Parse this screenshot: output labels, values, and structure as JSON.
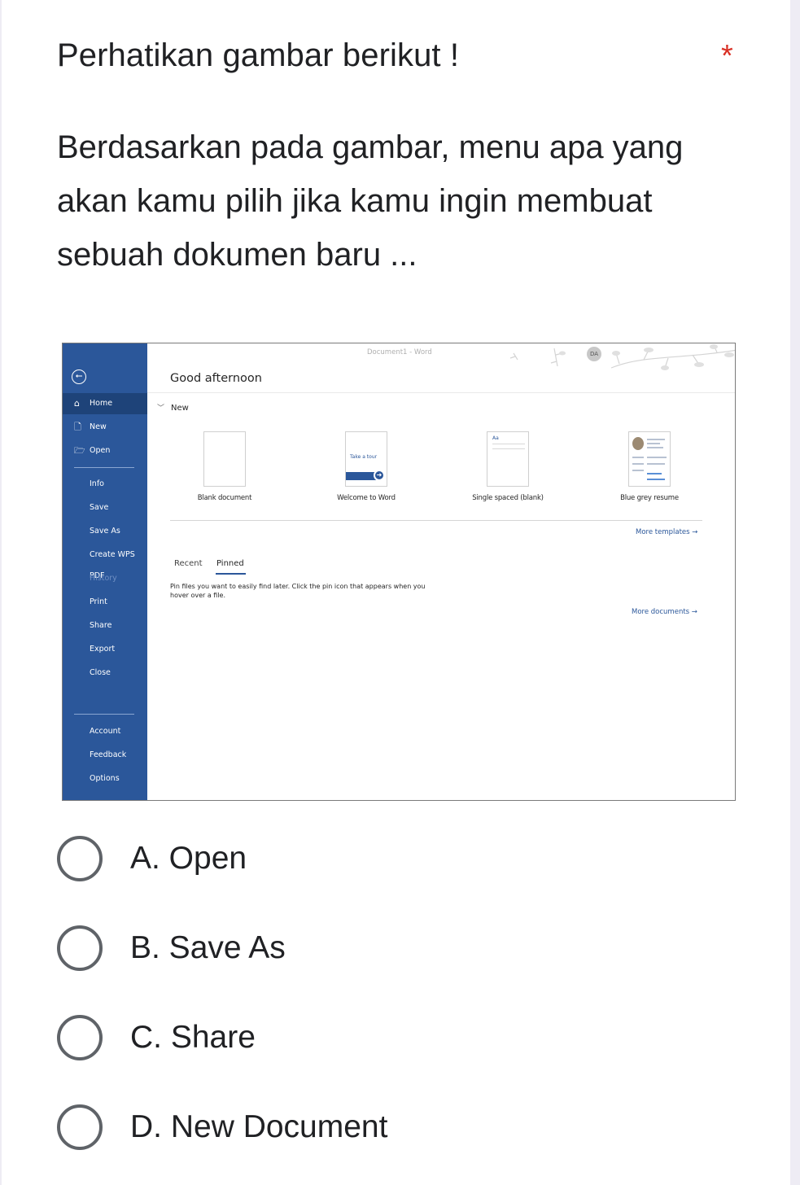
{
  "question": {
    "title": "Perhatikan gambar berikut !",
    "required_marker": "*",
    "body": "Berdasarkan pada gambar, menu apa yang akan kamu pilih jika kamu ingin membuat sebuah dokumen baru ..."
  },
  "word": {
    "window_title": "Document1 - Word",
    "avatar_initials": "DA",
    "greeting": "Good afternoon",
    "sidebar": {
      "back": "⭠",
      "items": [
        {
          "label": "Home",
          "icon": "home-icon"
        },
        {
          "label": "New",
          "icon": "new-document-icon"
        },
        {
          "label": "Open",
          "icon": "folder-open-icon"
        },
        {
          "label": "Info"
        },
        {
          "label": "Save"
        },
        {
          "label": "Save As"
        },
        {
          "label": "Create WPS PDF"
        },
        {
          "label": "History"
        },
        {
          "label": "Print"
        },
        {
          "label": "Share"
        },
        {
          "label": "Export"
        },
        {
          "label": "Close"
        },
        {
          "label": "Account"
        },
        {
          "label": "Feedback"
        },
        {
          "label": "Options"
        }
      ]
    },
    "new_section": {
      "heading": "New",
      "templates": [
        {
          "label": "Blank document"
        },
        {
          "label": "Welcome to Word",
          "thumb_text": "Take a tour"
        },
        {
          "label": "Single spaced (blank)",
          "thumb_text": "Aa"
        },
        {
          "label": "Blue grey resume"
        }
      ],
      "more_templates": "More templates →"
    },
    "files": {
      "tabs": [
        "Recent",
        "Pinned"
      ],
      "active_tab": "Pinned",
      "pinned_note": "Pin files you want to easily find later. Click the pin icon that appears when you hover over a file.",
      "more_documents": "More documents →"
    },
    "colors": {
      "sidebar": "#2b579a",
      "sidebar_active": "#1e4379"
    }
  },
  "options": [
    {
      "label": "A. Open"
    },
    {
      "label": "B. Save As"
    },
    {
      "label": "C. Share"
    },
    {
      "label": "D. New Document"
    }
  ]
}
